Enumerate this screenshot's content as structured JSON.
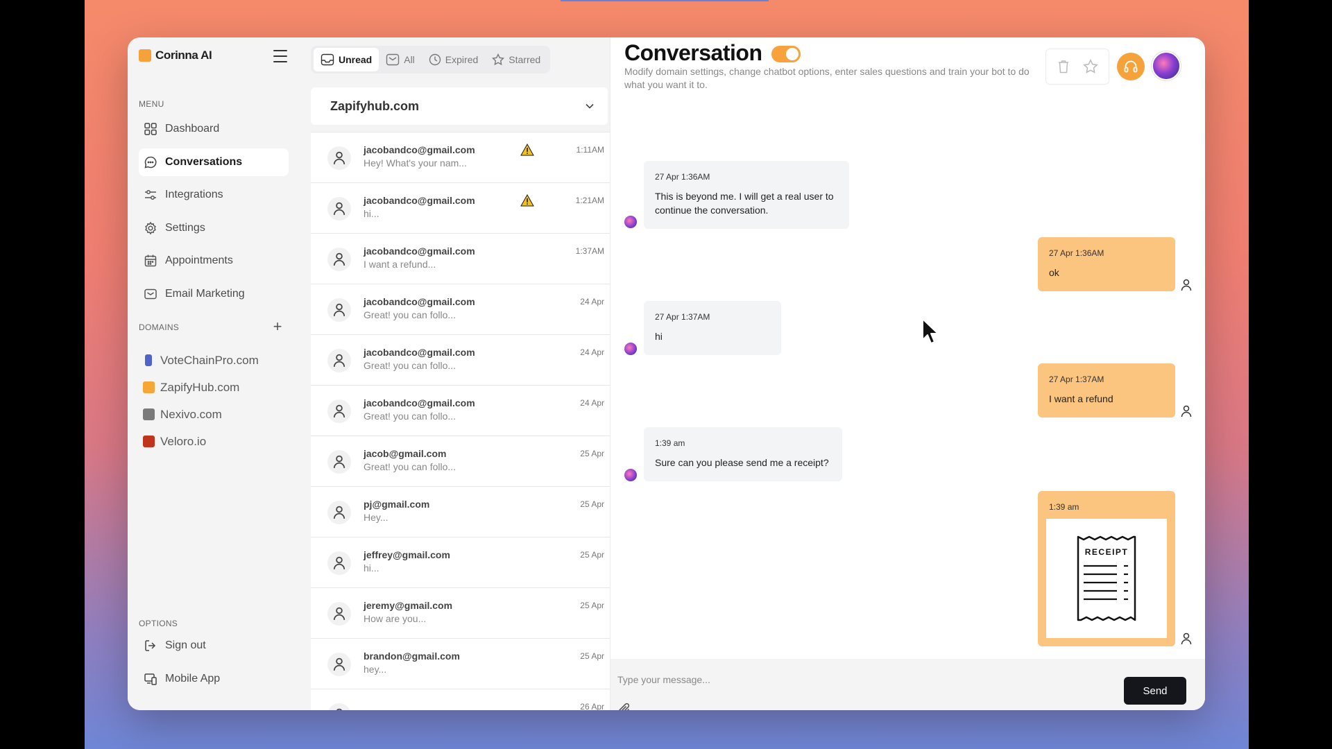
{
  "app": {
    "name": "Corinna AI"
  },
  "sidebar": {
    "menu_label": "MENU",
    "items": [
      {
        "label": "Dashboard",
        "icon": "dashboard-icon"
      },
      {
        "label": "Conversations",
        "icon": "chat-icon",
        "active": true
      },
      {
        "label": "Integrations",
        "icon": "sliders-icon"
      },
      {
        "label": "Settings",
        "icon": "gear-icon"
      },
      {
        "label": "Appointments",
        "icon": "calendar-icon"
      },
      {
        "label": "Email Marketing",
        "icon": "mail-icon"
      }
    ],
    "domains_label": "DOMAINS",
    "domains": [
      {
        "label": "VoteChainPro.com",
        "color": "#4f63c9"
      },
      {
        "label": "ZapifyHub.com",
        "color": "#f5a636"
      },
      {
        "label": "Nexivo.com",
        "color": "#7a7a7a"
      },
      {
        "label": "Veloro.io",
        "color": "#c0341d"
      }
    ],
    "options_label": "OPTIONS",
    "options": [
      {
        "label": "Sign out",
        "icon": "sign-out-icon"
      },
      {
        "label": "Mobile App",
        "icon": "devices-icon"
      }
    ]
  },
  "tabs": [
    {
      "label": "Unread",
      "active": true
    },
    {
      "label": "All"
    },
    {
      "label": "Expired"
    },
    {
      "label": "Starred"
    }
  ],
  "domain_select": {
    "value": "Zapifyhub.com"
  },
  "conversations": [
    {
      "email": "jacobandco@gmail.com",
      "preview": "Hey! What's your nam...",
      "time": "1:11AM",
      "warning": true
    },
    {
      "email": "jacobandco@gmail.com",
      "preview": "hi...",
      "time": "1:21AM",
      "warning": true
    },
    {
      "email": "jacobandco@gmail.com",
      "preview": "I want a refund...",
      "time": "1:37AM"
    },
    {
      "email": "jacobandco@gmail.com",
      "preview": "Great! you can follo...",
      "time": "24 Apr"
    },
    {
      "email": "jacobandco@gmail.com",
      "preview": "Great! you can follo...",
      "time": "24 Apr"
    },
    {
      "email": "jacobandco@gmail.com",
      "preview": "Great! you can follo...",
      "time": "24 Apr"
    },
    {
      "email": "jacob@gmail.com",
      "preview": "Great! you can follo...",
      "time": "25 Apr"
    },
    {
      "email": "pj@gmail.com",
      "preview": "Hey...",
      "time": "25 Apr"
    },
    {
      "email": "jeffrey@gmail.com",
      "preview": "hi...",
      "time": "25 Apr"
    },
    {
      "email": "jeremy@gmail.com",
      "preview": "How are you...",
      "time": "25 Apr"
    },
    {
      "email": "brandon@gmail.com",
      "preview": "hey...",
      "time": "25 Apr"
    },
    {
      "email": "",
      "preview": "",
      "time": "26 Apr"
    }
  ],
  "header": {
    "title": "Conversation",
    "subtitle": "Modify domain settings, change chatbot options, enter sales questions and train your bot to do what you want it to."
  },
  "messages": [
    {
      "role": "bot",
      "meta": "27 Apr  1:36AM",
      "text": "This is beyond me. I will get a real user to continue the conversation."
    },
    {
      "role": "user",
      "meta": "27 Apr  1:36AM",
      "text": "ok"
    },
    {
      "role": "bot",
      "meta": "27 Apr  1:37AM",
      "text": "hi"
    },
    {
      "role": "user",
      "meta": "27 Apr  1:37AM",
      "text": "I want a refund"
    },
    {
      "role": "bot",
      "meta": "1:39 am",
      "text": "Sure can you please send me a receipt?"
    },
    {
      "role": "user",
      "meta": "1:39 am",
      "text": "",
      "attachment_label": "RECEIPT"
    }
  ],
  "composer": {
    "placeholder": "Type your message...",
    "send_label": "Send"
  },
  "colors": {
    "accent": "#f6a23b",
    "user_bubble": "#fbc47f",
    "send": "#15161c"
  }
}
